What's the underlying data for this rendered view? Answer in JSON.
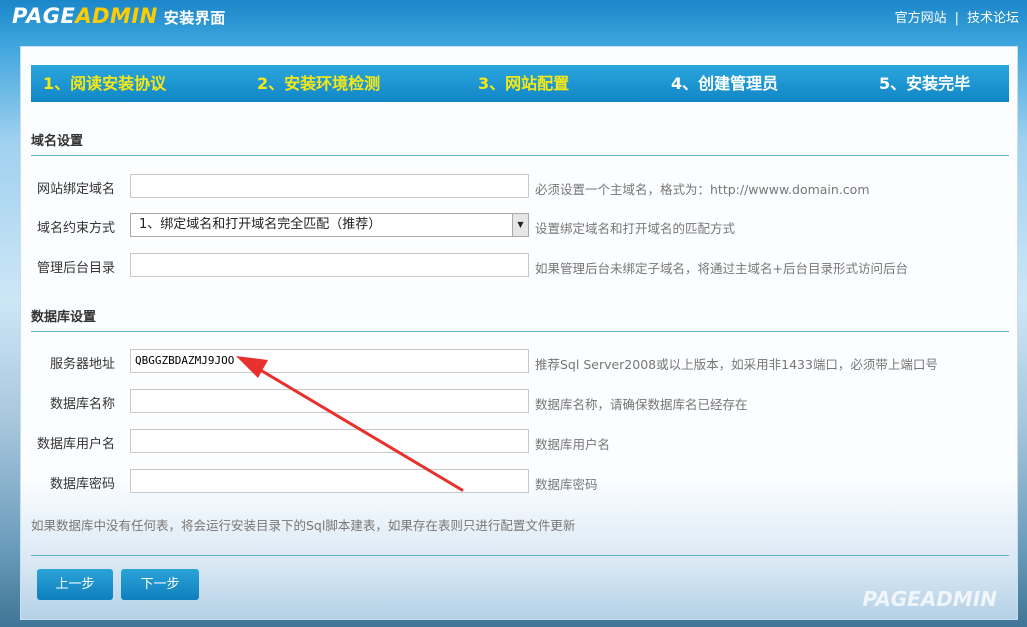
{
  "header": {
    "logo_part1": "PAGE",
    "logo_part2": "ADMIN",
    "logo_sub": "安装界面",
    "link_official": "官方网站",
    "link_separator": "|",
    "link_forum": "技术论坛"
  },
  "steps": [
    {
      "label": "1、阅读安装协议",
      "state": "done"
    },
    {
      "label": "2、安装环境检测",
      "state": "done"
    },
    {
      "label": "3、网站配置",
      "state": "current"
    },
    {
      "label": "4、创建管理员",
      "state": "todo"
    },
    {
      "label": "5、安装完毕",
      "state": "todo"
    }
  ],
  "domain_section": {
    "title": "域名设置",
    "bind_domain": {
      "label": "网站绑定域名",
      "value": "",
      "hint": "必须设置一个主域名，格式为：http://wwww.domain.com"
    },
    "match_mode": {
      "label": "域名约束方式",
      "selected": "1、绑定域名和打开域名完全匹配（推荐）",
      "hint": "设置绑定域名和打开域名的匹配方式"
    },
    "admin_dir": {
      "label": "管理后台目录",
      "value": "",
      "hint": "如果管理后台未绑定子域名，将通过主域名+后台目录形式访问后台"
    }
  },
  "db_section": {
    "title": "数据库设置",
    "server": {
      "label": "服务器地址",
      "value": "QBGGZBDAZMJ9JOO",
      "hint": "推荐Sql Server2008或以上版本，如采用非1433端口，必须带上端口号"
    },
    "db_name": {
      "label": "数据库名称",
      "value": "",
      "hint": "数据库名称，请确保数据库名已经存在"
    },
    "db_user": {
      "label": "数据库用户名",
      "value": "",
      "hint": "数据库用户名"
    },
    "db_pass": {
      "label": "数据库密码",
      "value": "",
      "hint": "数据库密码"
    },
    "note": "如果数据库中没有任何表，将会运行安装目录下的Sql脚本建表，如果存在表则只进行配置文件更新"
  },
  "buttons": {
    "prev": "上一步",
    "next": "下一步"
  },
  "watermark": "PAGEADMIN",
  "colors": {
    "step_done": "#f5e814",
    "step_todo": "#ffffff",
    "annotation_arrow": "#e8302c",
    "button": "#1391cf"
  }
}
